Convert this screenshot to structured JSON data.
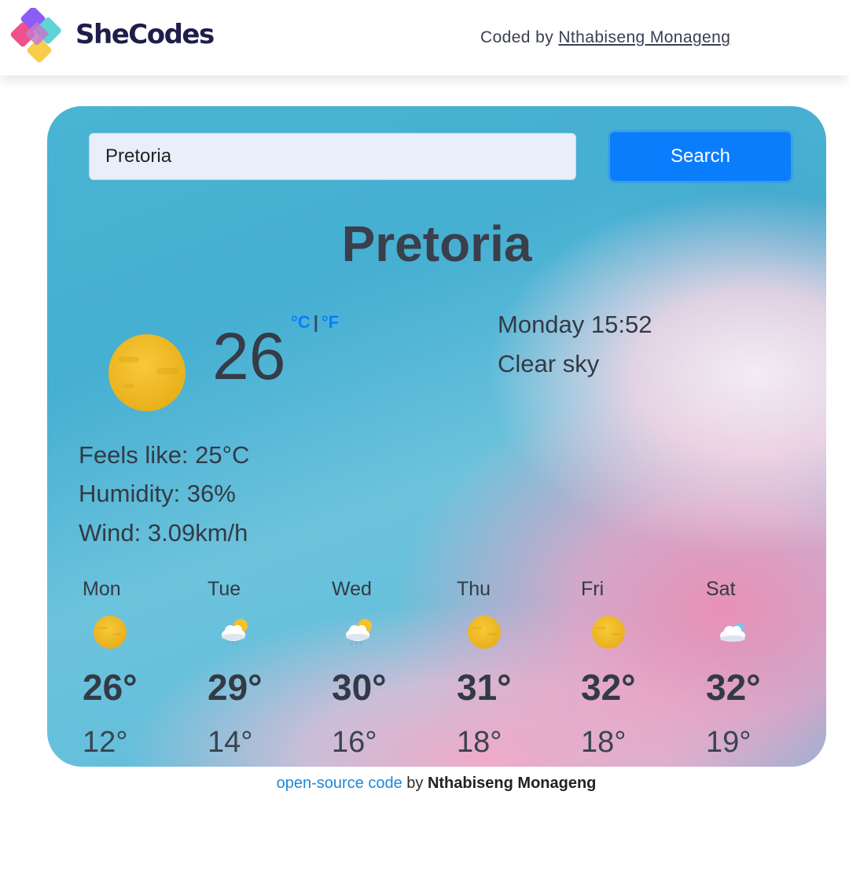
{
  "header": {
    "brand": "SheCodes",
    "credit_prefix": "Coded by",
    "credit_name": "Nthabiseng Monageng"
  },
  "search": {
    "value": "Pretoria",
    "button_label": "Search"
  },
  "current": {
    "city": "Pretoria",
    "temperature": "26",
    "unit_c": "°C",
    "unit_sep": "|",
    "unit_f": "°F",
    "datetime": "Monday 15:52",
    "description": "Clear sky",
    "icon": "sun-icon",
    "feels_like": "Feels like: 25°C",
    "humidity": "Humidity: 36%",
    "wind": "Wind: 3.09km/h"
  },
  "forecast": [
    {
      "day": "Mon",
      "max": "26°",
      "min": "12°",
      "icon": "sun-icon"
    },
    {
      "day": "Tue",
      "max": "29°",
      "min": "14°",
      "icon": "sun-cloud-rain-icon"
    },
    {
      "day": "Wed",
      "max": "30°",
      "min": "16°",
      "icon": "sun-cloud-rain-icon"
    },
    {
      "day": "Thu",
      "max": "31°",
      "min": "18°",
      "icon": "sun-icon"
    },
    {
      "day": "Fri",
      "max": "32°",
      "min": "18°",
      "icon": "sun-icon"
    },
    {
      "day": "Sat",
      "max": "32°",
      "min": "19°",
      "icon": "cloud-icon"
    }
  ],
  "footer": {
    "link_text": "open-source code",
    "by": "by",
    "author": "Nthabiseng Monageng"
  },
  "colors": {
    "accent": "#0a7dfd",
    "brand_text": "#1f1d4a",
    "link": "#1e88d8"
  }
}
